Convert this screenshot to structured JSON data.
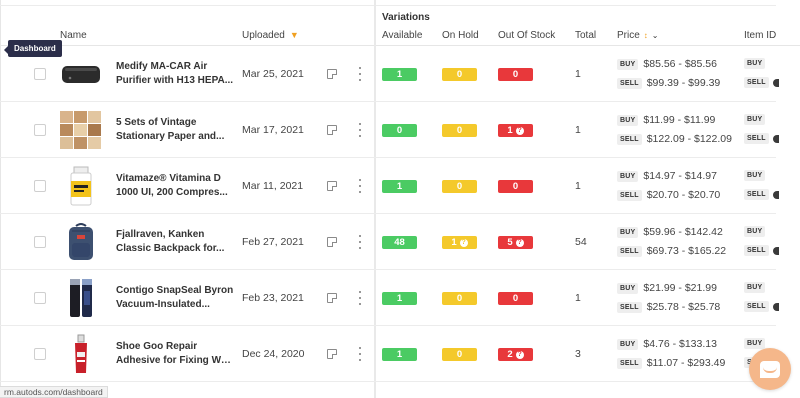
{
  "header": {
    "name": "Name",
    "uploaded": "Uploaded",
    "variations": "Variations",
    "available": "Available",
    "on_hold": "On Hold",
    "out_of_stock": "Out Of Stock",
    "total": "Total",
    "price": "Price",
    "item_id": "Item ID"
  },
  "tooltip": "Dashboard",
  "status_url": "rm.autods.com/dashboard",
  "price_tags": {
    "buy": "BUY",
    "sell": "SELL"
  },
  "colors": {
    "available": "#4bcb63",
    "on_hold": "#f4c92b",
    "out_of_stock": "#e8383b",
    "sort_accent": "#f0a020",
    "chat": "#f5b78a",
    "tooltip": "#2b2e4a"
  },
  "rows": [
    {
      "name_line1": "Medify MA-CAR Air",
      "name_line2": "Purifier with H13 HEPA...",
      "uploaded": "Mar 25, 2021",
      "available": "1",
      "on_hold": "0",
      "out_of_stock": "0",
      "total": "1",
      "buy": "$85.56 - $85.56",
      "sell": "$99.39 - $99.39",
      "thumb": "air-purifier"
    },
    {
      "name_line1": "5 Sets of Vintage",
      "name_line2": "Stationary Paper and...",
      "uploaded": "Mar 17, 2021",
      "available": "0",
      "on_hold": "0",
      "out_of_stock": "1",
      "total": "1",
      "buy": "$11.99 - $11.99",
      "sell": "$122.09 - $122.09",
      "thumb": "stationery"
    },
    {
      "name_line1": "Vitamaze® Vitamina D",
      "name_line2": "1000 UI, 200 Compres...",
      "uploaded": "Mar 11, 2021",
      "available": "1",
      "on_hold": "0",
      "out_of_stock": "0",
      "total": "1",
      "buy": "$14.97 - $14.97",
      "sell": "$20.70 - $20.70",
      "thumb": "vitamin-bottle"
    },
    {
      "name_line1": "Fjallraven, Kanken",
      "name_line2": "Classic Backpack for...",
      "uploaded": "Feb 27, 2021",
      "available": "48",
      "on_hold": "1",
      "out_of_stock": "5",
      "total": "54",
      "buy": "$59.96 - $142.42",
      "sell": "$69.73 - $165.22",
      "thumb": "backpack"
    },
    {
      "name_line1": "Contigo SnapSeal Byron",
      "name_line2": "Vacuum-Insulated...",
      "uploaded": "Feb 23, 2021",
      "available": "1",
      "on_hold": "0",
      "out_of_stock": "0",
      "total": "1",
      "buy": "$21.99 - $21.99",
      "sell": "$25.78 - $25.78",
      "thumb": "tumblers"
    },
    {
      "name_line1": "Shoe Goo Repair",
      "name_line2": "Adhesive for Fixing Wor...",
      "uploaded": "Dec 24, 2020",
      "available": "1",
      "on_hold": "0",
      "out_of_stock": "2",
      "total": "3",
      "buy": "$4.76 - $133.13",
      "sell": "$11.07 - $293.49",
      "thumb": "glue-tube"
    }
  ]
}
